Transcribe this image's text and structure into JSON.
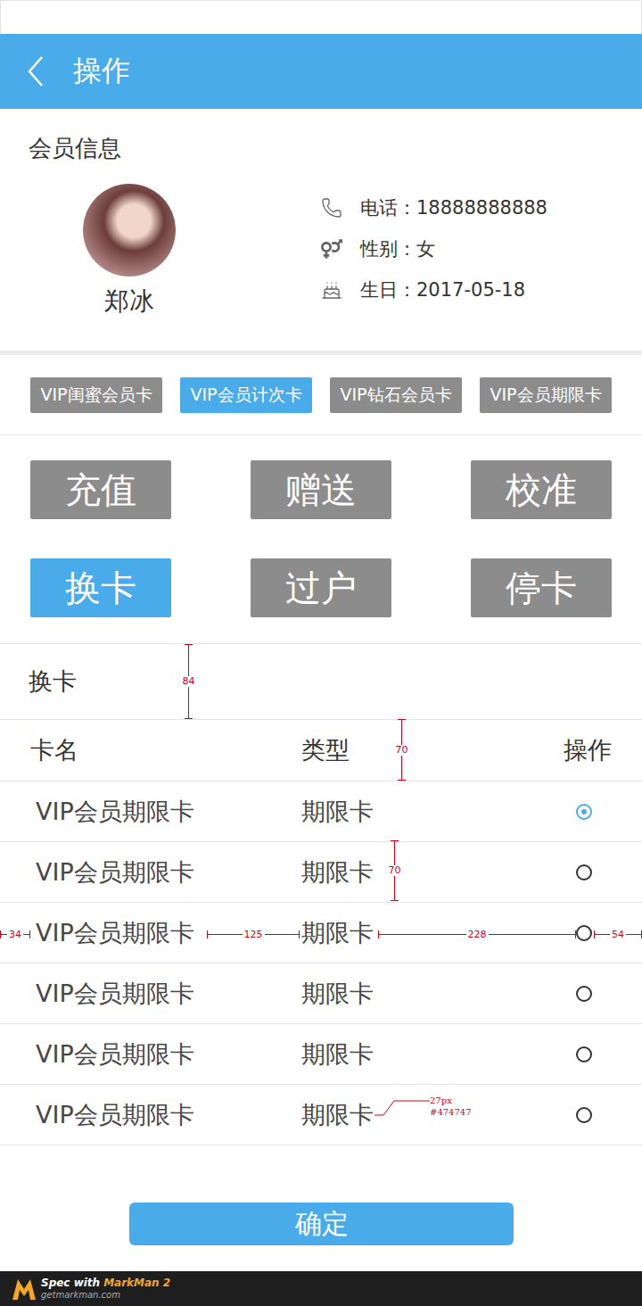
{
  "header": {
    "title": "操作"
  },
  "member": {
    "section_title": "会员信息",
    "name": "郑冰",
    "info": [
      {
        "kind": "phone",
        "text": "电话：18888888888"
      },
      {
        "kind": "gender",
        "text": "性别：女"
      },
      {
        "kind": "birthday",
        "text": "生日：2017-05-18"
      }
    ]
  },
  "cards": [
    {
      "label": "VIP闺蜜会员卡",
      "selected": false
    },
    {
      "label": "VIP会员计次卡",
      "selected": true
    },
    {
      "label": "VIP钻石会员卡",
      "selected": false
    },
    {
      "label": "VIP会员期限卡",
      "selected": false
    }
  ],
  "actions": [
    {
      "label": "充值",
      "selected": false
    },
    {
      "label": "赠送",
      "selected": false
    },
    {
      "label": "校准",
      "selected": false
    },
    {
      "label": "换卡",
      "selected": true
    },
    {
      "label": "过户",
      "selected": false
    },
    {
      "label": "停卡",
      "selected": false
    }
  ],
  "panel": {
    "title": "换卡",
    "columns": [
      "卡名",
      "类型",
      "操作"
    ],
    "rows": [
      {
        "name": "VIP会员期限卡",
        "type": "期限卡",
        "selected": true
      },
      {
        "name": "VIP会员期限卡",
        "type": "期限卡",
        "selected": false
      },
      {
        "name": "VIP会员期限卡",
        "type": "期限卡",
        "selected": false
      },
      {
        "name": "VIP会员期限卡",
        "type": "期限卡",
        "selected": false
      },
      {
        "name": "VIP会员期限卡",
        "type": "期限卡",
        "selected": false
      },
      {
        "name": "VIP会员期限卡",
        "type": "期限卡",
        "selected": false
      }
    ]
  },
  "confirm": "确定",
  "annotations": {
    "measures": [
      {
        "label": "84"
      },
      {
        "label": "70"
      },
      {
        "label": "70"
      },
      {
        "label": "34"
      },
      {
        "label": "125"
      },
      {
        "label": "228"
      },
      {
        "label": "54"
      }
    ],
    "note": [
      "27px",
      "#474747"
    ]
  },
  "footer": {
    "prefix": "Spec with",
    "brand": "MarkMan 2",
    "site": "getmarkman.com"
  }
}
